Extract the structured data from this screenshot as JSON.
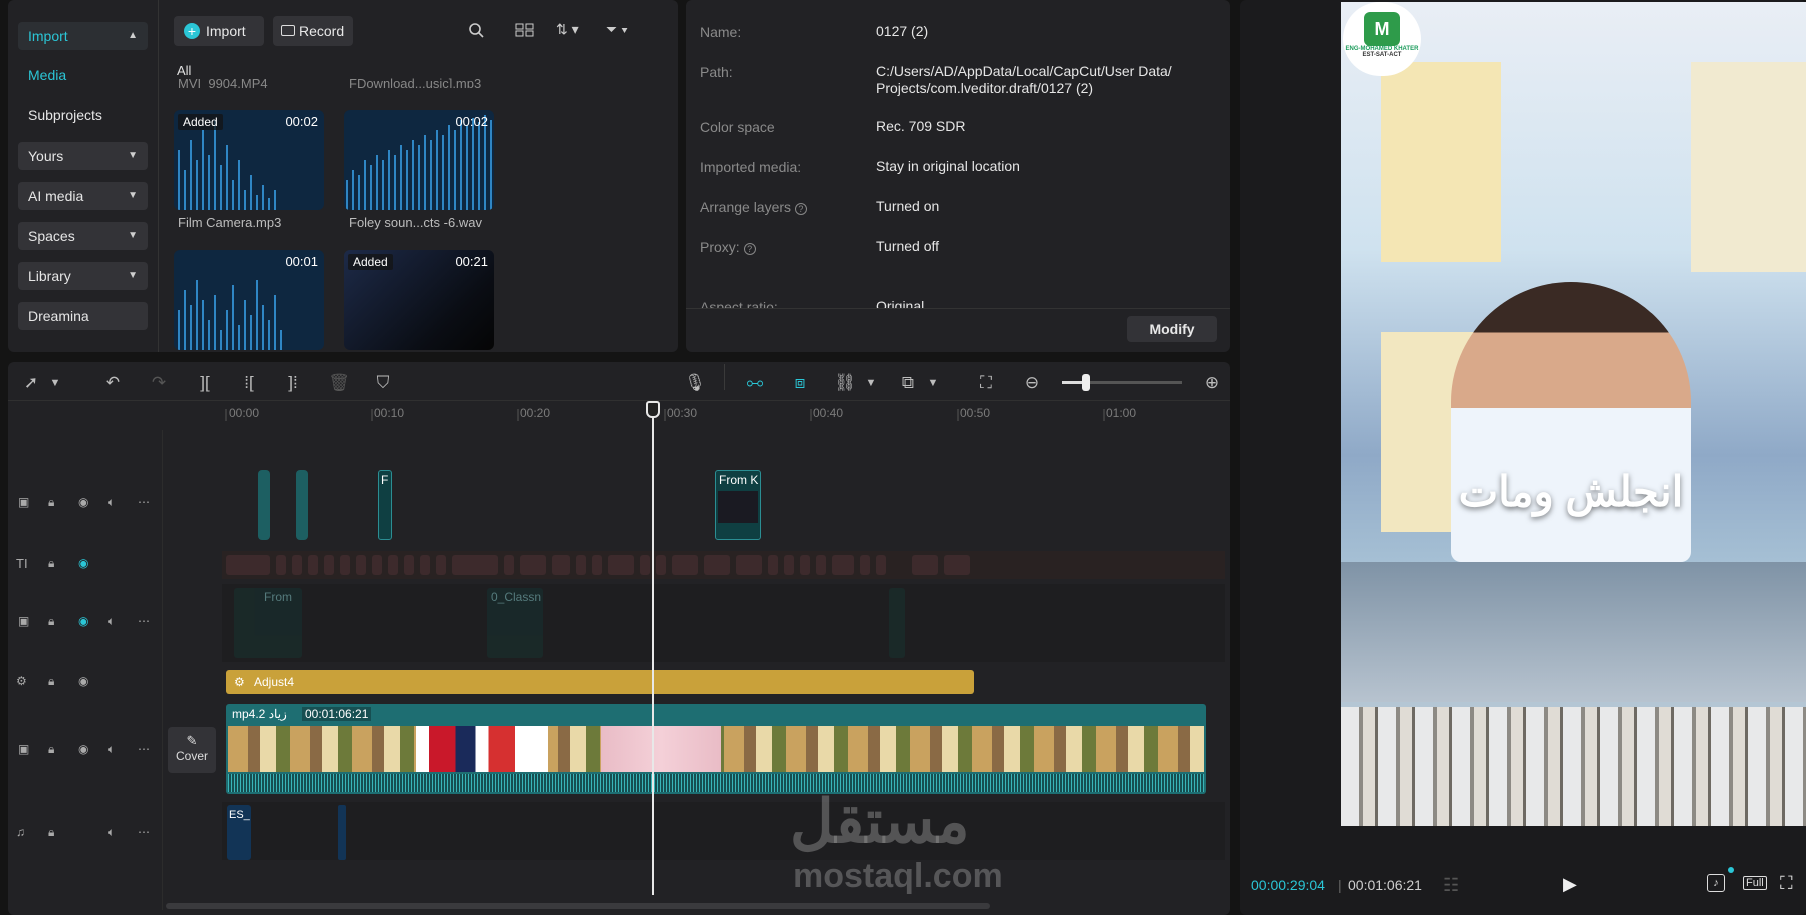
{
  "media_nav": {
    "import": "Import",
    "media": "Media",
    "subprojects": "Subprojects",
    "yours": "Yours",
    "ai_media": "AI media",
    "spaces": "Spaces",
    "library": "Library",
    "dreamina": "Dreamina"
  },
  "media_toolbar": {
    "import_button": "Import",
    "record_button": "Record",
    "filter_all": "All"
  },
  "media_items": [
    {
      "name": "MVI_9904.MP4"
    },
    {
      "name": "FDownload...usic].mp3"
    },
    {
      "name": "Film Camera.mp3",
      "duration": "00:02",
      "badge": "Added"
    },
    {
      "name": "Foley soun...cts -6.wav",
      "duration": "00:02"
    },
    {
      "name": "",
      "duration": "00:01"
    },
    {
      "name": "",
      "duration": "00:21",
      "badge": "Added"
    }
  ],
  "details": {
    "name_label": "Name:",
    "name_value": "0127 (2)",
    "path_label": "Path:",
    "path_value_1": "C:/Users/AD/AppData/Local/CapCut/User Data/",
    "path_value_2": "Projects/com.lveditor.draft/0127 (2)",
    "color_label": "Color space",
    "color_value": "Rec. 709 SDR",
    "imported_label": "Imported media:",
    "imported_value": "Stay in original location",
    "arrange_label": "Arrange layers",
    "arrange_value": "Turned on",
    "proxy_label": "Proxy:",
    "proxy_value": "Turned off",
    "aspect_label": "Aspect ratio:",
    "aspect_value": "Original",
    "modify_button": "Modify"
  },
  "timeline": {
    "ruler": [
      "00:00",
      "00:10",
      "00:20",
      "00:30",
      "00:40",
      "00:50",
      "01:00"
    ],
    "playhead_fraction": 0.4545,
    "clips": {
      "f_label": "F",
      "fromk_label": "From K",
      "from_label": "From",
      "classn_label": "0_Classn",
      "adjust_label": "Adjust4",
      "main_name": "mp4.2 زياد",
      "main_duration": "00:01:06:21",
      "cover_label": "Cover",
      "audio_label": "ES_"
    }
  },
  "player": {
    "overlay_text": "انجلش ومات",
    "logo_text": "ENG-MOHAMED KHATER",
    "logo_sub": "EST-SAT-ACT",
    "current_time": "00:00:29:04",
    "total_time": "00:01:06:21",
    "full_label": "Full"
  },
  "watermark": {
    "arabic": "مستقل",
    "latin": "mostaql.com"
  },
  "colors": {
    "accent": "#2bc6d6",
    "adjust": "#c9a13a",
    "track_teal": "#1e6e72"
  }
}
